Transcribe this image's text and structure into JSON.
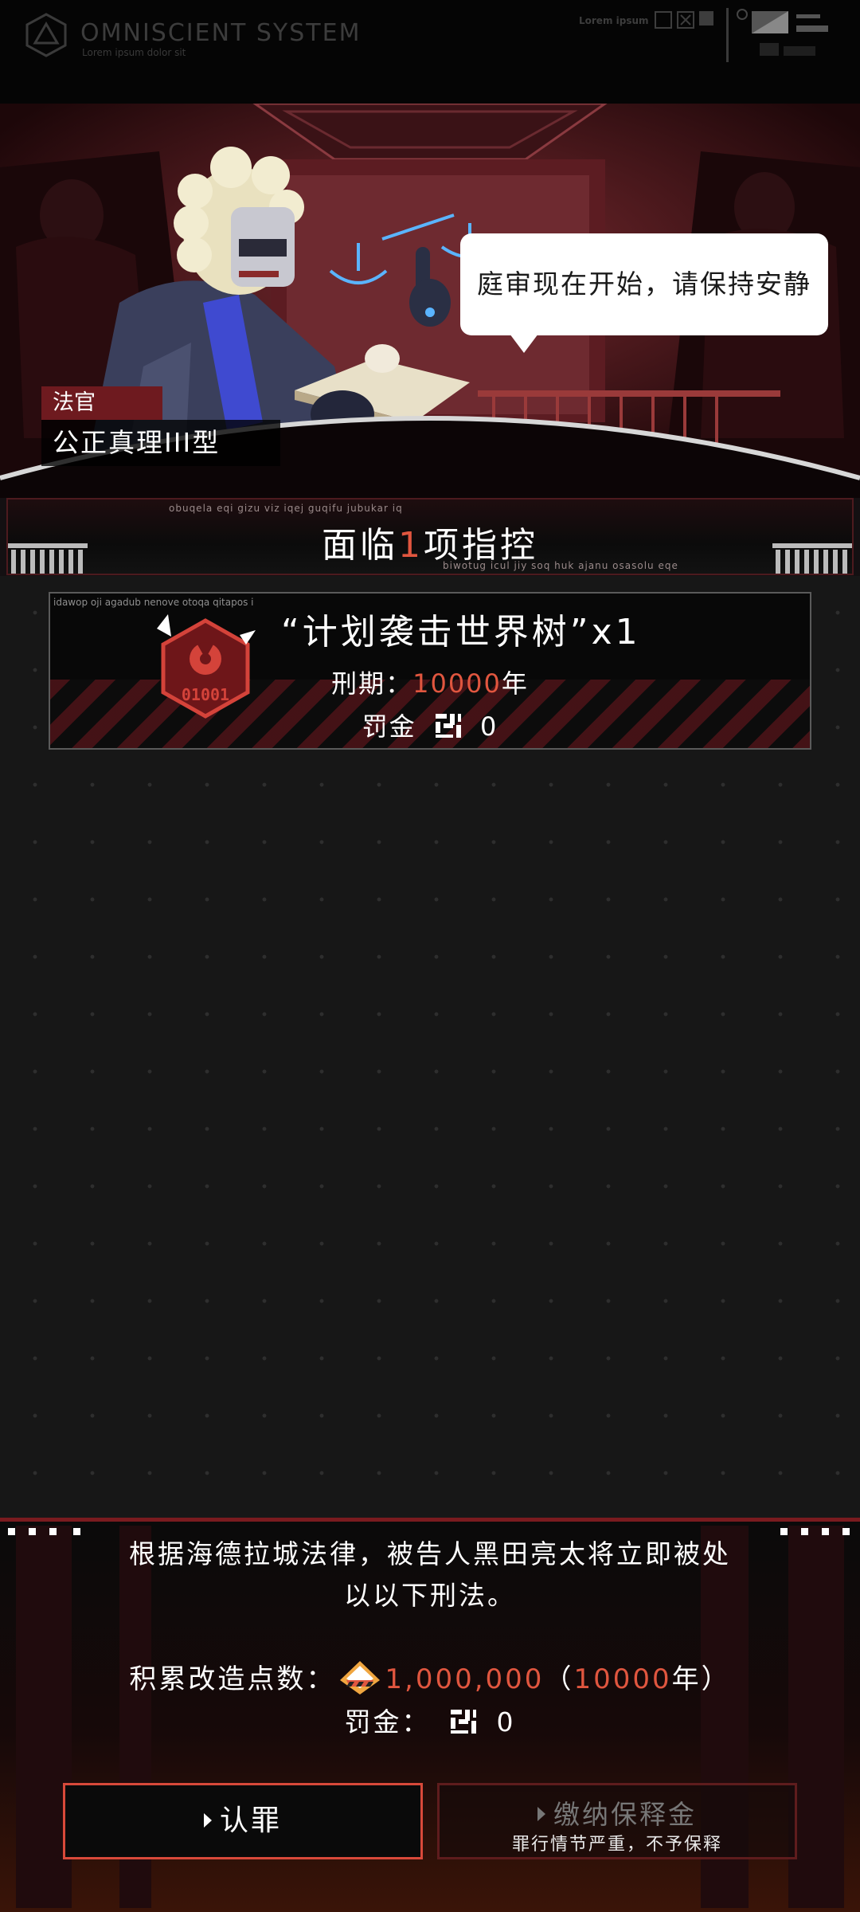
{
  "header": {
    "system_title": "OMNISCIENT  SYSTEM",
    "system_subtitle": "Lorem ipsum dolor sit",
    "top_label": "Lorem ipsum"
  },
  "scene": {
    "speech": "庭审现在开始，请保持安静",
    "judge_role": "法官",
    "judge_name": "公正真理III型"
  },
  "banner": {
    "title_prefix": "面临",
    "charge_count": "1",
    "title_suffix": "项指控",
    "tiny_top": "obuqela eqi gizu viz iqej guqifu jubukar iq",
    "tiny_bottom": "biwotug icul jiy soq huk ajanu osasolu eqe"
  },
  "charge_card": {
    "tiny_text": "idawop oji agadub nenove otoqa qitapos i",
    "title": "“计划袭击世界树”x1",
    "icon_binary": "01001",
    "term_label": "刑期：",
    "term_value": "10000",
    "term_unit": "年",
    "fine_label": "罚金",
    "fine_value": "0"
  },
  "verdict": {
    "text": "根据海德拉城法律，被告人黑田亮太将立即被处以以下刑法。",
    "points_label": "积累改造点数：",
    "points_value": "1,000,000",
    "points_paren_open": "（",
    "points_years": "10000",
    "points_years_unit": "年",
    "points_paren_close": "）",
    "fine_label": "罚金：",
    "fine_value": "0"
  },
  "buttons": {
    "plead_label": "认罪",
    "bail_label": "缴纳保释金",
    "bail_note": "罪行情节严重，不予保释"
  },
  "colors": {
    "accent": "#e0563f",
    "crimson": "#c0392b",
    "background": "#171717"
  }
}
